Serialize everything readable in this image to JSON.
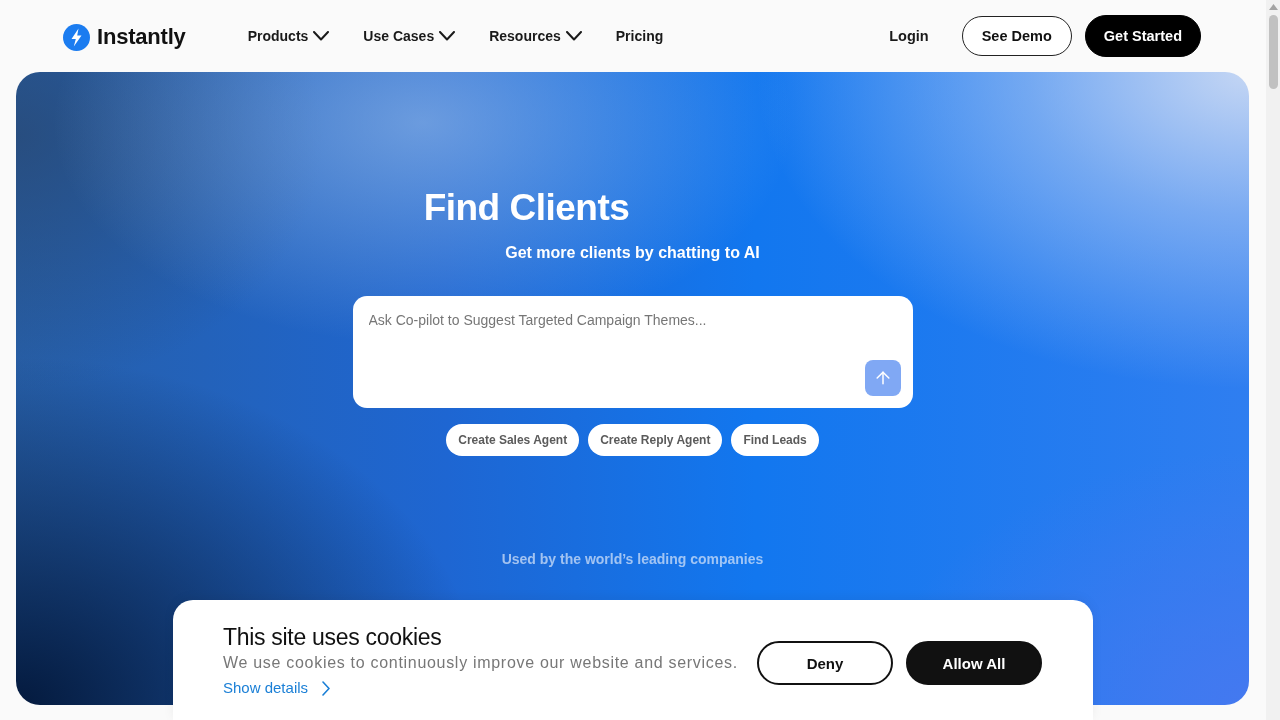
{
  "header": {
    "logo": {
      "text": "Instantly"
    },
    "nav": [
      {
        "label": "Products",
        "kind": "dropdown"
      },
      {
        "label": "Use Cases",
        "kind": "dropdown"
      },
      {
        "label": "Resources",
        "kind": "dropdown"
      },
      {
        "label": "Pricing",
        "kind": "link"
      }
    ],
    "actions": [
      {
        "label": "Login",
        "kind": "link"
      },
      {
        "label": "See Demo",
        "kind": "outline"
      },
      {
        "label": "Get Started",
        "kind": "filled"
      }
    ]
  },
  "hero": {
    "title": "Find Clients",
    "subtitle": "Get more clients by chatting to AI",
    "prompt": {
      "placeholder": "Ask Co-pilot to Suggest Targeted Campaign Themes...",
      "send_button": {
        "disabled": true
      }
    },
    "suggestions": [
      {
        "label": "Create Sales Agent"
      },
      {
        "label": "Create Reply Agent"
      },
      {
        "label": "Find Leads"
      }
    ],
    "trust_line": "Used by the world’s leading companies"
  },
  "cookie_banner": {
    "title": "This site uses cookies",
    "text": "We use cookies to continuously improve our website and services.",
    "details_link": "Show details",
    "buttons": [
      {
        "label": "Deny",
        "kind": "outline"
      },
      {
        "label": "Allow All",
        "kind": "filled"
      }
    ]
  }
}
